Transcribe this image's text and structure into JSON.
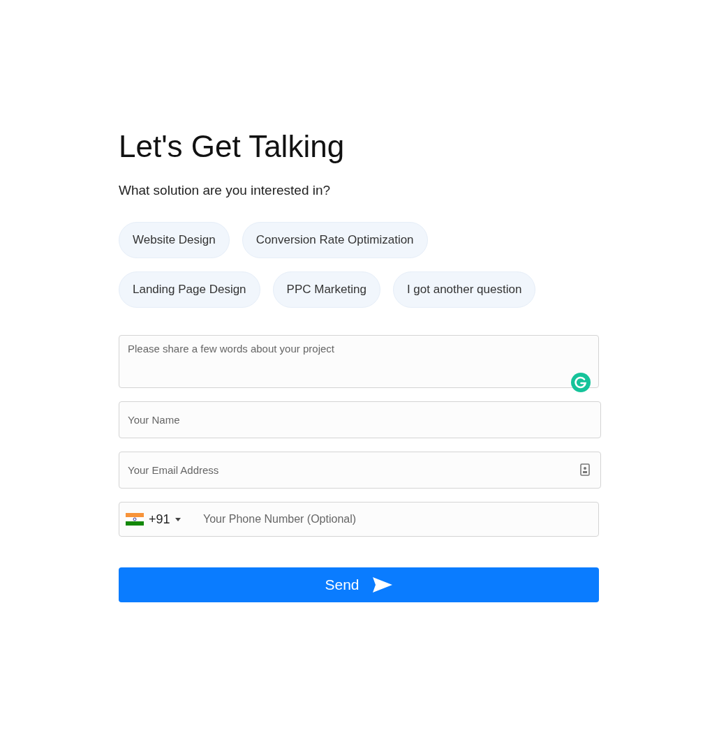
{
  "heading": "Let's Get Talking",
  "question": "What solution are you interested in?",
  "options": [
    {
      "label": "Website Design",
      "selected": false
    },
    {
      "label": "Conversion Rate Optimization",
      "selected": false
    },
    {
      "label": "Landing Page Design",
      "selected": false
    },
    {
      "label": "PPC Marketing",
      "selected": false
    },
    {
      "label": "I got another question",
      "selected": false
    }
  ],
  "project": {
    "placeholder": "Please share a few words about your project"
  },
  "name": {
    "placeholder": "Your Name"
  },
  "email": {
    "placeholder": "Your Email Address"
  },
  "phone": {
    "dial_code": "+91",
    "placeholder": "Your Phone Number (Optional)"
  },
  "submit": "Send"
}
